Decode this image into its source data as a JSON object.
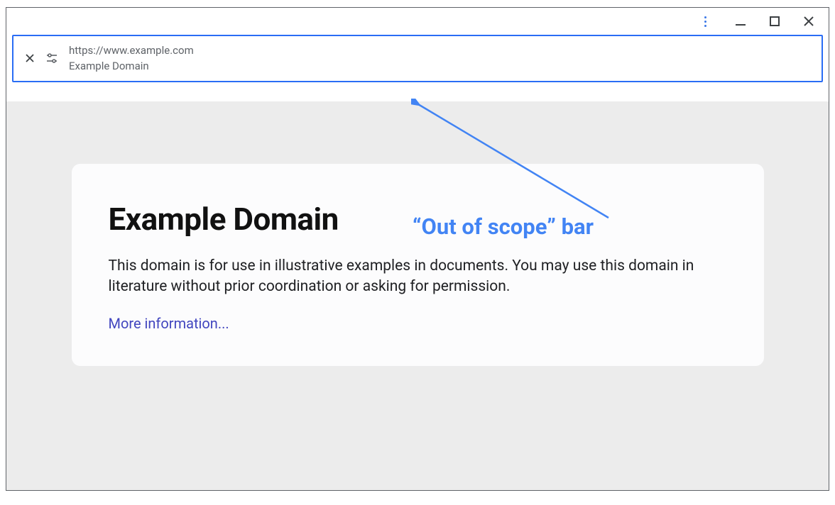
{
  "address_bar": {
    "url": "https://www.example.com",
    "title": "Example Domain"
  },
  "page": {
    "heading": "Example Domain",
    "body": "This domain is for use in illustrative examples in documents. You may use this domain in literature without prior coordination or asking for permission.",
    "link_text": "More information..."
  },
  "annotation": {
    "label": "“Out of scope” bar"
  }
}
